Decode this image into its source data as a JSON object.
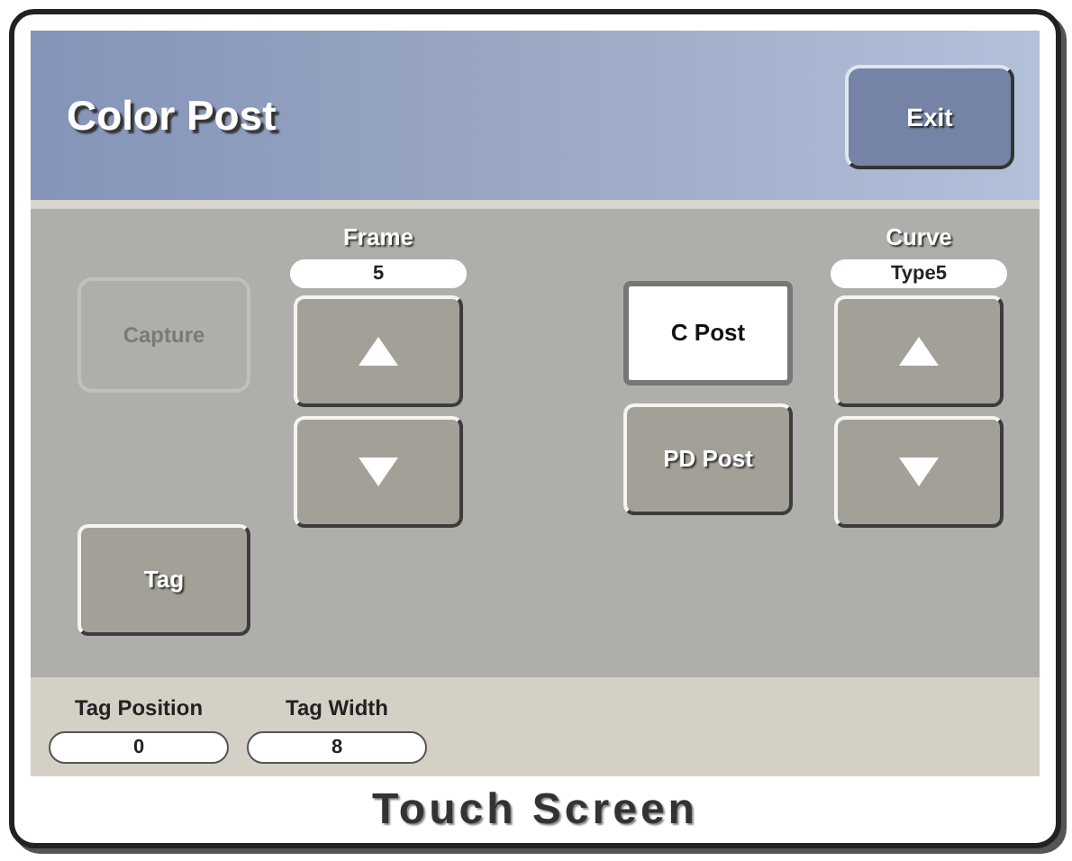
{
  "header": {
    "title": "Color Post",
    "exit_button": "Exit"
  },
  "capture_button": {
    "label": "Capture",
    "disabled": true
  },
  "tag_button": {
    "label": "Tag",
    "disabled": false
  },
  "frame": {
    "label": "Frame",
    "value": "5"
  },
  "post_buttons": [
    {
      "label": "C Post",
      "selected": true
    },
    {
      "label": "PD Post",
      "selected": false
    }
  ],
  "curve": {
    "label": "Curve",
    "value": "Type5"
  },
  "tag_fields": [
    {
      "label": "Tag Position",
      "value": "0"
    },
    {
      "label": "Tag Width",
      "value": "8"
    }
  ],
  "footer": "Touch Screen"
}
